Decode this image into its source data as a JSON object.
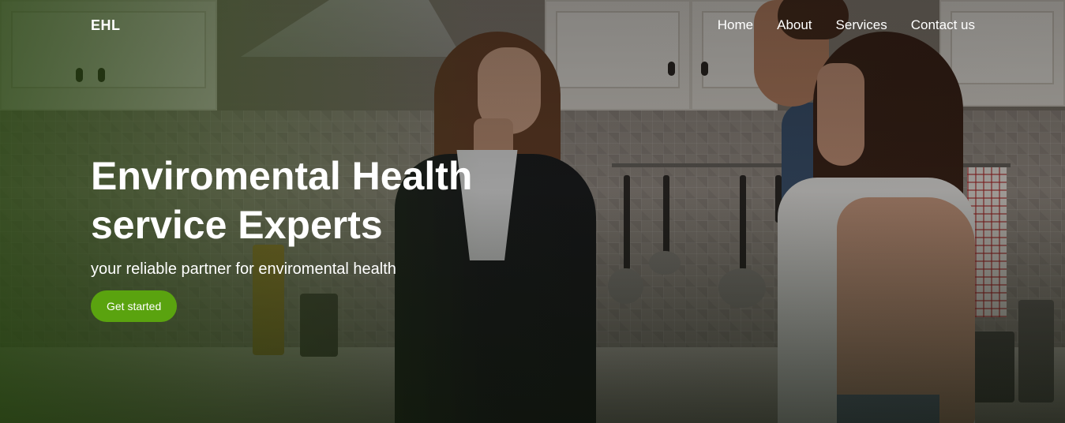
{
  "header": {
    "brand": "EHL",
    "nav": [
      {
        "label": "Home"
      },
      {
        "label": "About"
      },
      {
        "label": "Services"
      },
      {
        "label": "Contact us"
      }
    ]
  },
  "hero": {
    "title_line1": "Enviromental Health",
    "title_line2": "service Experts",
    "subtitle": "your reliable partner for enviromental health",
    "cta_label": "Get started",
    "background_image": "kitchen-inspection-photo"
  },
  "colors": {
    "accent": "#5aa30f",
    "text": "#ffffff",
    "overlay_tint": "#22400c"
  }
}
